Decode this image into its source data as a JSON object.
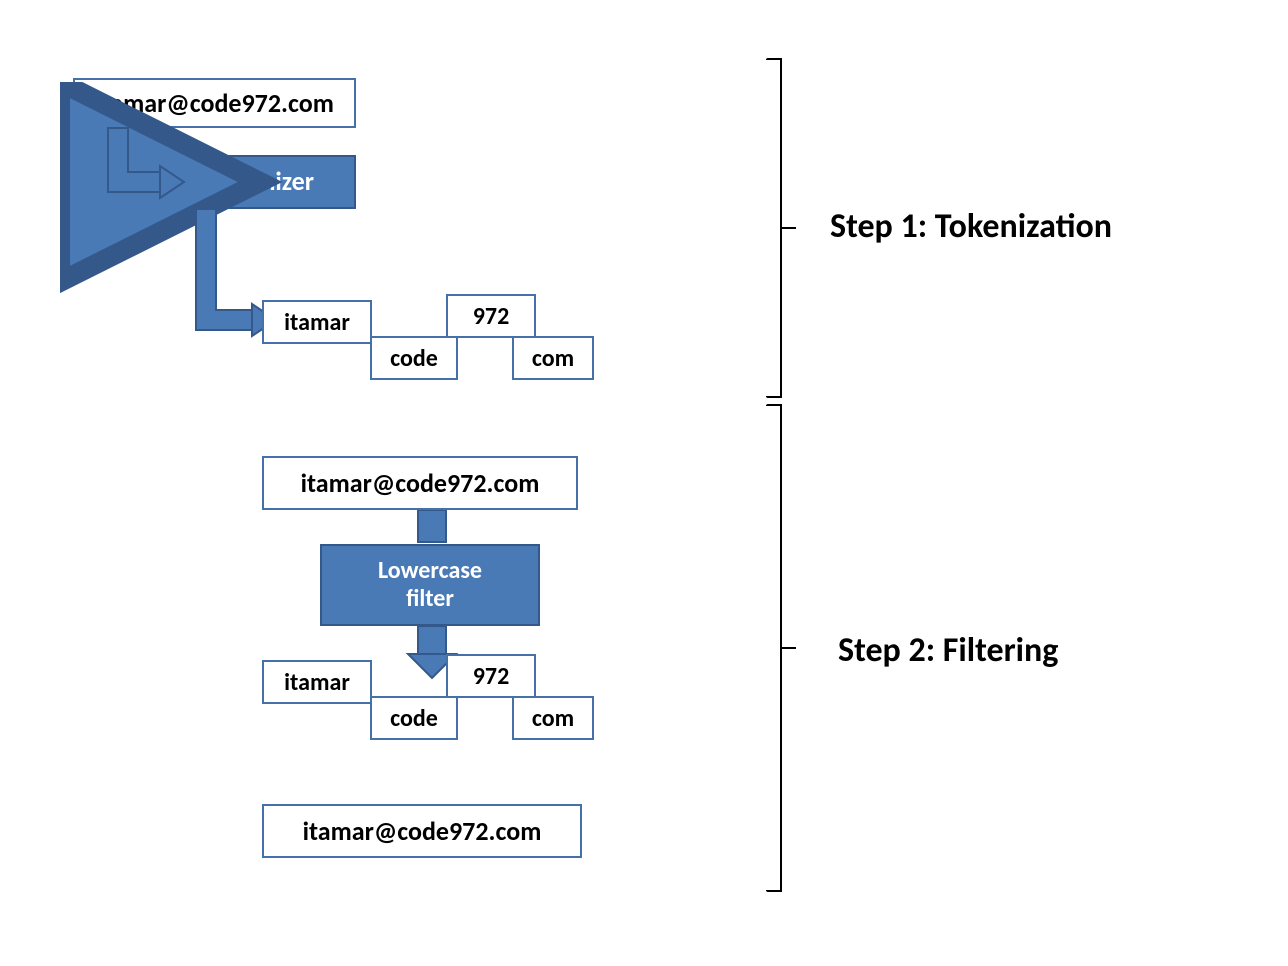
{
  "colors": {
    "blue": "#4a7ab6",
    "blueBorder": "#34588a",
    "boxBorder": "#4472a8"
  },
  "step1": {
    "label": "Step 1: Tokenization",
    "input": "itamar@code972.com",
    "process_label": "Tokenizer",
    "tokens": {
      "t1": "itamar",
      "t2": "code",
      "t3": "972",
      "t4": "com"
    }
  },
  "step2": {
    "label": "Step 2: Filtering",
    "input_top": "itamar@code972.com",
    "process_label": "Lowercase\nfilter",
    "tokens": {
      "t1": "itamar",
      "t2": "code",
      "t3": "972",
      "t4": "com"
    },
    "output_bottom": "itamar@code972.com"
  }
}
